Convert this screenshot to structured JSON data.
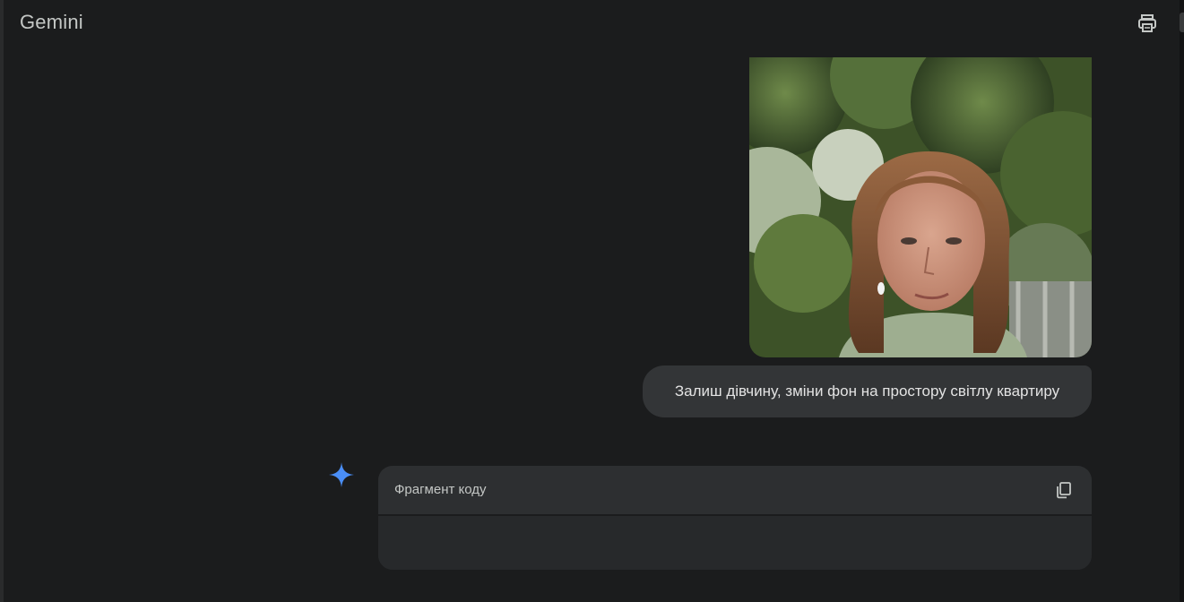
{
  "app": {
    "title": "Gemini"
  },
  "header": {
    "action_icon": "print-icon"
  },
  "conversation": {
    "user_message": {
      "attachment": {
        "kind": "photo",
        "description_icon": "image-attachment"
      },
      "text": "Залиш дівчину, зміни фон на простору світлу квартиру"
    },
    "assistant_message": {
      "avatar_icon": "gemini-spark-icon",
      "code_block": {
        "label": "Фрагмент коду",
        "copy_icon": "copy-icon",
        "content": ""
      }
    }
  },
  "colors": {
    "background": "#1b1c1d",
    "bubble": "#333537",
    "code_header": "#2d2f31",
    "code_body": "#27292b",
    "accent_blue": "#4a8ef7"
  }
}
